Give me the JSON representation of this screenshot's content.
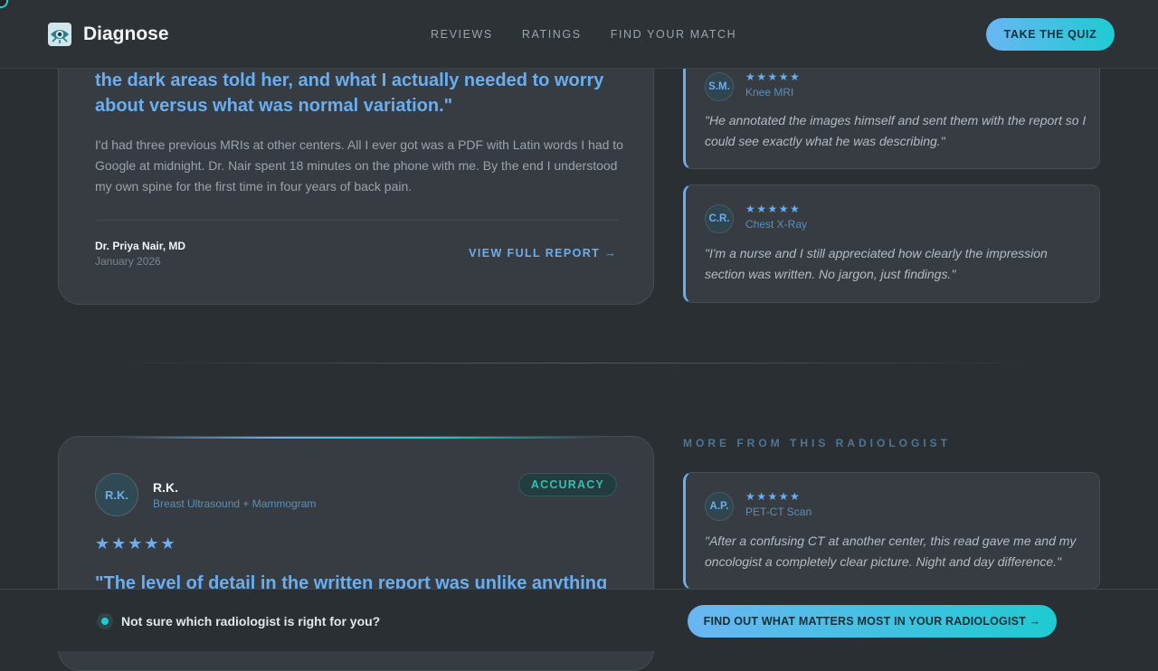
{
  "header": {
    "brand": "Diagnose",
    "nav": [
      "REVIEWS",
      "RATINGS",
      "FIND YOUR MATCH"
    ],
    "cta": "TAKE THE QUIZ"
  },
  "featured_top": {
    "quote": "the dark areas told her, and what I actually needed to worry about versus what was normal variation.\"",
    "body": "I'd had three previous MRIs at other centers. All I ever got was a PDF with Latin words I had to Google at midnight. Dr. Nair spent 18 minutes on the phone with me. By the end I understood my own spine for the first time in four years of back pain.",
    "author": "Dr. Priya Nair, MD",
    "date": "January 2026",
    "link": "VIEW FULL REPORT →"
  },
  "side_reviews_top": [
    {
      "initials": "S.M.",
      "stars": "★★★★★",
      "scan": "Knee MRI",
      "text": "\"He annotated the images himself and sent them with the report so I could see exactly what he was describing.\""
    },
    {
      "initials": "C.R.",
      "stars": "★★★★★",
      "scan": "Chest X-Ray",
      "text": "\"I'm a nurse and I still appreciated how clearly the impression section was written. No jargon, just findings.\""
    }
  ],
  "featured_bottom": {
    "initials": "R.K.",
    "name": "R.K.",
    "scan": "Breast Ultrasound + Mammogram",
    "badge": "ACCURACY",
    "stars": "★★★★★",
    "quote": "\"The level of detail in the written report was unlike anything"
  },
  "more_section": {
    "heading": "MORE FROM THIS RADIOLOGIST",
    "reviews": [
      {
        "initials": "A.P.",
        "stars": "★★★★★",
        "scan": "PET-CT Scan",
        "text": "\"After a confusing CT at another center, this read gave me and my oncologist a completely clear picture. Night and day difference.\""
      }
    ]
  },
  "bottom_bar": {
    "question": "Not sure which radiologist is right for you?",
    "cta": "FIND OUT WHAT MATTERS MOST IN YOUR RADIOLOGIST →"
  },
  "colors": {
    "accent_blue": "#6aaef0",
    "accent_teal": "#1ecbd2",
    "background": "#2a2f33",
    "card": "#363c41"
  }
}
